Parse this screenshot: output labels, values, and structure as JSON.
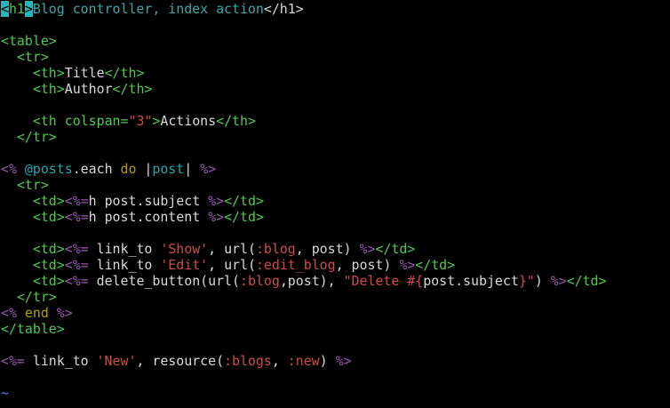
{
  "editor": {
    "lines": [
      [
        {
          "t": "<",
          "c": "cur"
        },
        {
          "t": "h1",
          "c": "tag"
        },
        {
          "t": ">",
          "c": "cur"
        },
        {
          "t": "Blog controller, index action",
          "c": "cmt"
        },
        {
          "t": "</h1>",
          "c": "def"
        }
      ],
      [],
      [
        {
          "t": "<table>",
          "c": "tag"
        }
      ],
      [
        {
          "t": "  ",
          "c": "def"
        },
        {
          "t": "<tr>",
          "c": "tag"
        }
      ],
      [
        {
          "t": "    ",
          "c": "def"
        },
        {
          "t": "<th>",
          "c": "tag"
        },
        {
          "t": "Title",
          "c": "def"
        },
        {
          "t": "</th>",
          "c": "tag"
        }
      ],
      [
        {
          "t": "    ",
          "c": "def"
        },
        {
          "t": "<th>",
          "c": "tag"
        },
        {
          "t": "Author",
          "c": "def"
        },
        {
          "t": "</th>",
          "c": "tag"
        }
      ],
      [],
      [
        {
          "t": "    ",
          "c": "def"
        },
        {
          "t": "<th ",
          "c": "tag"
        },
        {
          "t": "colspan=",
          "c": "attr"
        },
        {
          "t": "\"3\"",
          "c": "str"
        },
        {
          "t": ">",
          "c": "tag"
        },
        {
          "t": "Actions",
          "c": "def"
        },
        {
          "t": "</th>",
          "c": "tag"
        }
      ],
      [
        {
          "t": "  ",
          "c": "def"
        },
        {
          "t": "</tr>",
          "c": "tag"
        }
      ],
      [],
      [
        {
          "t": "<%",
          "c": "erb"
        },
        {
          "t": " ",
          "c": "def"
        },
        {
          "t": "@posts",
          "c": "ivar"
        },
        {
          "t": ".each ",
          "c": "def"
        },
        {
          "t": "do",
          "c": "kw"
        },
        {
          "t": " |",
          "c": "def"
        },
        {
          "t": "post",
          "c": "ivar"
        },
        {
          "t": "| ",
          "c": "def"
        },
        {
          "t": "%>",
          "c": "erb"
        }
      ],
      [
        {
          "t": "  ",
          "c": "def"
        },
        {
          "t": "<tr>",
          "c": "tag"
        }
      ],
      [
        {
          "t": "    ",
          "c": "def"
        },
        {
          "t": "<td>",
          "c": "tag"
        },
        {
          "t": "<%=",
          "c": "erb"
        },
        {
          "t": "h post.subject ",
          "c": "def"
        },
        {
          "t": "%>",
          "c": "erb"
        },
        {
          "t": "</td>",
          "c": "tag"
        }
      ],
      [
        {
          "t": "    ",
          "c": "def"
        },
        {
          "t": "<td>",
          "c": "tag"
        },
        {
          "t": "<%=",
          "c": "erb"
        },
        {
          "t": "h post.content ",
          "c": "def"
        },
        {
          "t": "%>",
          "c": "erb"
        },
        {
          "t": "</td>",
          "c": "tag"
        }
      ],
      [],
      [
        {
          "t": "    ",
          "c": "def"
        },
        {
          "t": "<td>",
          "c": "tag"
        },
        {
          "t": "<%=",
          "c": "erb"
        },
        {
          "t": " link_to ",
          "c": "def"
        },
        {
          "t": "'Show'",
          "c": "str"
        },
        {
          "t": ", url(",
          "c": "def"
        },
        {
          "t": ":blog",
          "c": "sym"
        },
        {
          "t": ", post) ",
          "c": "def"
        },
        {
          "t": "%>",
          "c": "erb"
        },
        {
          "t": "</td>",
          "c": "tag"
        }
      ],
      [
        {
          "t": "    ",
          "c": "def"
        },
        {
          "t": "<td>",
          "c": "tag"
        },
        {
          "t": "<%=",
          "c": "erb"
        },
        {
          "t": " link_to ",
          "c": "def"
        },
        {
          "t": "'Edit'",
          "c": "str"
        },
        {
          "t": ", url(",
          "c": "def"
        },
        {
          "t": ":edit_blog",
          "c": "sym"
        },
        {
          "t": ", post) ",
          "c": "def"
        },
        {
          "t": "%>",
          "c": "erb"
        },
        {
          "t": "</td>",
          "c": "tag"
        }
      ],
      [
        {
          "t": "    ",
          "c": "def"
        },
        {
          "t": "<td>",
          "c": "tag"
        },
        {
          "t": "<%=",
          "c": "erb"
        },
        {
          "t": " delete_button(url(",
          "c": "def"
        },
        {
          "t": ":blog",
          "c": "sym"
        },
        {
          "t": ",post), ",
          "c": "def"
        },
        {
          "t": "\"Delete #{",
          "c": "str"
        },
        {
          "t": "post.subject",
          "c": "def"
        },
        {
          "t": "}\"",
          "c": "str"
        },
        {
          "t": ") ",
          "c": "def"
        },
        {
          "t": "%>",
          "c": "erb"
        },
        {
          "t": "</td>",
          "c": "tag"
        }
      ],
      [
        {
          "t": "  ",
          "c": "def"
        },
        {
          "t": "</tr>",
          "c": "tag"
        }
      ],
      [
        {
          "t": "<%",
          "c": "erb"
        },
        {
          "t": " ",
          "c": "def"
        },
        {
          "t": "end",
          "c": "kw"
        },
        {
          "t": " ",
          "c": "def"
        },
        {
          "t": "%>",
          "c": "erb"
        }
      ],
      [
        {
          "t": "</table>",
          "c": "tag"
        }
      ],
      [],
      [
        {
          "t": "<%=",
          "c": "erb"
        },
        {
          "t": " link_to ",
          "c": "def"
        },
        {
          "t": "'New'",
          "c": "str"
        },
        {
          "t": ", resource(",
          "c": "def"
        },
        {
          "t": ":blogs",
          "c": "sym"
        },
        {
          "t": ", ",
          "c": "def"
        },
        {
          "t": ":new",
          "c": "sym"
        },
        {
          "t": ") ",
          "c": "def"
        },
        {
          "t": "%>",
          "c": "erb"
        }
      ],
      [],
      [
        {
          "t": "~",
          "c": "tilde"
        }
      ]
    ]
  },
  "colors": {
    "background": "#000000",
    "cursor": "#2ab5b8",
    "tag": "#4fc94f",
    "string": "#d04a4a",
    "erb": "#9a57b0",
    "ivar": "#22a8b0",
    "keyword": "#b3a000",
    "tilde": "#4d86ff"
  }
}
